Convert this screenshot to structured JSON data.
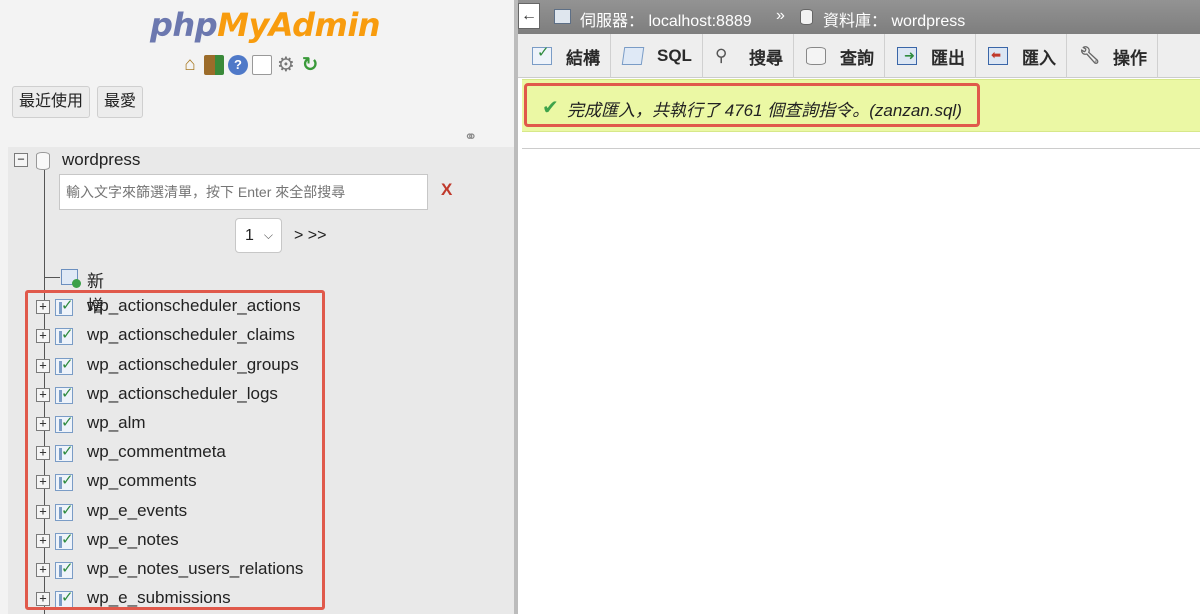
{
  "logo": {
    "php": "php",
    "my": "My",
    "admin": "Admin"
  },
  "nav_icons": [
    "home-icon",
    "exit-icon",
    "help-icon",
    "docs-icon",
    "settings-icon",
    "reload-icon"
  ],
  "left_tabs": {
    "recent": "最近使用",
    "favorites": "最愛"
  },
  "tree": {
    "database": "wordpress",
    "filter_placeholder": "輸入文字來篩選清單，按下 Enter 來全部搜尋",
    "clear": "X",
    "page_select": "1",
    "page_next": "> >>",
    "new_label": "新增",
    "tables": [
      "wp_actionscheduler_actions",
      "wp_actionscheduler_claims",
      "wp_actionscheduler_groups",
      "wp_actionscheduler_logs",
      "wp_alm",
      "wp_commentmeta",
      "wp_comments",
      "wp_e_events",
      "wp_e_notes",
      "wp_e_notes_users_relations",
      "wp_e_submissions"
    ]
  },
  "breadcrumb": {
    "back": "←",
    "server": "伺服器： localhost:8889",
    "separator": "»",
    "database": "資料庫： wordpress"
  },
  "tabs": {
    "structure": "結構",
    "sql": "SQL",
    "search": "搜尋",
    "query": "查詢",
    "export": "匯出",
    "import": "匯入",
    "operations": "操作"
  },
  "notice": {
    "message": "完成匯入，共執行了 4761 個查詢指令。(zanzan.sql)",
    "accent_color": "#ebf8a4"
  },
  "highlight_color": "#e0594b"
}
